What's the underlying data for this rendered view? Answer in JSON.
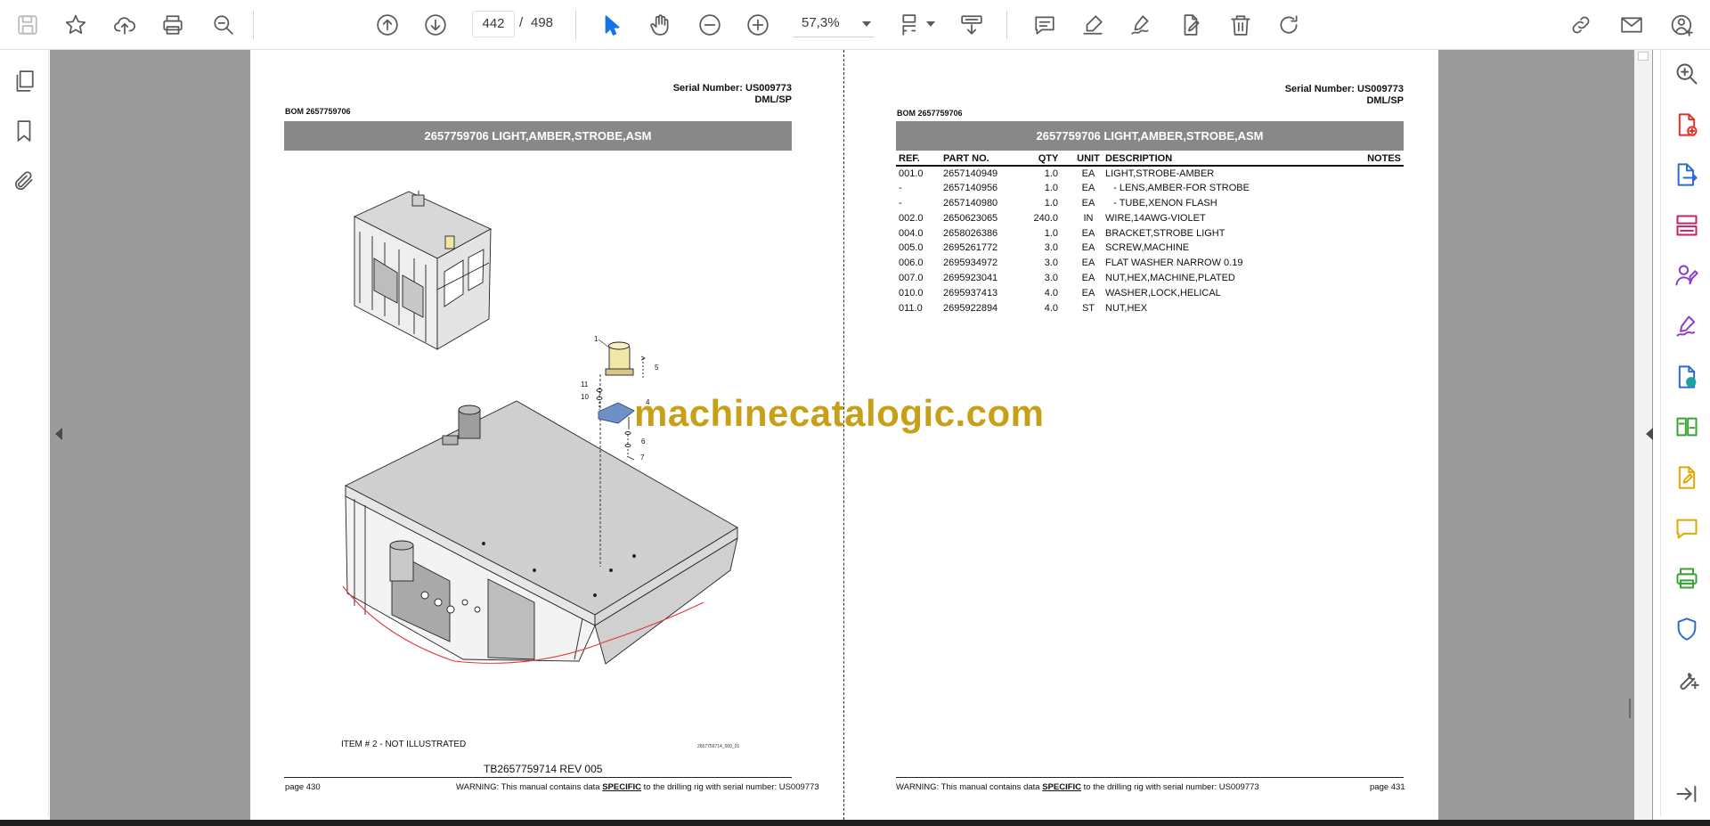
{
  "toolbar": {
    "page_current": "442",
    "page_separator": "/",
    "page_total": "498",
    "zoom": "57,3%",
    "icons": [
      "save-icon",
      "bookmark-star-icon",
      "upload-cloud-icon",
      "print-icon",
      "zoom-search-icon",
      "page-up-icon",
      "page-down-icon",
      "select-cursor-icon",
      "hand-tool-icon",
      "zoom-out-icon",
      "zoom-in-icon",
      "fit-page-icon",
      "scroll-mode-icon",
      "comment-icon",
      "highlight-icon",
      "sign-icon",
      "fill-sign-icon",
      "delete-icon",
      "rotate-icon",
      "share-link-icon",
      "email-icon",
      "account-icon"
    ]
  },
  "left_page": {
    "serial_number": "Serial Number: US009773",
    "dml": "DML/SP",
    "bom": "BOM 2657759706",
    "title": "2657759706 LIGHT,AMBER,STROBE,ASM",
    "note": "ITEM # 2 - NOT ILLUSTRATED",
    "drawing_id": "2657759714_000_01",
    "revision": "TB2657759714 REV 005",
    "page_label": "page 430",
    "warning_prefix": "WARNING:  This manual contains data ",
    "warning_emph": "SPECIFIC",
    "warning_suffix": " to the drilling rig with serial number: US009773",
    "callouts": [
      "1",
      "5",
      "11",
      "10",
      "4",
      "6",
      "7"
    ]
  },
  "right_page": {
    "serial_number": "Serial Number: US009773",
    "dml": "DML/SP",
    "bom": "BOM 2657759706",
    "title": "2657759706 LIGHT,AMBER,STROBE,ASM",
    "page_label": "page 431",
    "warning_prefix": "WARNING:  This manual contains data ",
    "warning_emph": "SPECIFIC",
    "warning_suffix": " to the drilling rig with serial number: US009773",
    "columns": [
      "REF.",
      "PART NO.",
      "QTY",
      "UNIT",
      "DESCRIPTION",
      "NOTES"
    ],
    "rows": [
      {
        "ref": "001.0",
        "part": "2657140949",
        "qty": "1.0",
        "unit": "EA",
        "desc": "LIGHT,STROBE-AMBER"
      },
      {
        "ref": "-",
        "part": "2657140956",
        "qty": "1.0",
        "unit": "EA",
        "desc": "   - LENS,AMBER-FOR STROBE"
      },
      {
        "ref": "-",
        "part": "2657140980",
        "qty": "1.0",
        "unit": "EA",
        "desc": "   - TUBE,XENON FLASH"
      },
      {
        "ref": "002.0",
        "part": "2650623065",
        "qty": "240.0",
        "unit": "IN",
        "desc": "WIRE,14AWG-VIOLET"
      },
      {
        "ref": "004.0",
        "part": "2658026386",
        "qty": "1.0",
        "unit": "EA",
        "desc": "BRACKET,STROBE LIGHT"
      },
      {
        "ref": "005.0",
        "part": "2695261772",
        "qty": "3.0",
        "unit": "EA",
        "desc": "SCREW,MACHINE"
      },
      {
        "ref": "006.0",
        "part": "2695934972",
        "qty": "3.0",
        "unit": "EA",
        "desc": "FLAT WASHER NARROW 0.19"
      },
      {
        "ref": "007.0",
        "part": "2695923041",
        "qty": "3.0",
        "unit": "EA",
        "desc": "NUT,HEX,MACHINE,PLATED"
      },
      {
        "ref": "010.0",
        "part": "2695937413",
        "qty": "4.0",
        "unit": "EA",
        "desc": "WASHER,LOCK,HELICAL"
      },
      {
        "ref": "011.0",
        "part": "2695922894",
        "qty": "4.0",
        "unit": "ST",
        "desc": "NUT,HEX"
      }
    ]
  },
  "watermark": "machinecatalogic.com",
  "left_rail_icons": [
    "pages-thumbnail-icon",
    "bookmark-icon",
    "attachment-icon"
  ],
  "right_rail_icons": [
    "zoom-search-icon",
    "create-pdf-icon",
    "export-pdf-icon",
    "organize-pages-icon",
    "request-signature-icon",
    "fill-sign-icon",
    "convert-pdf-icon",
    "compare-files-icon",
    "edit-pdf-icon",
    "comment-icon",
    "print-production-icon",
    "protect-icon",
    "more-tools-icon",
    "expand-panel-icon"
  ],
  "colors": {
    "accent": "#1473e6",
    "title_bar": "#888888",
    "watermark": "#c8a018",
    "doc_bg": "#9b9b9b"
  }
}
